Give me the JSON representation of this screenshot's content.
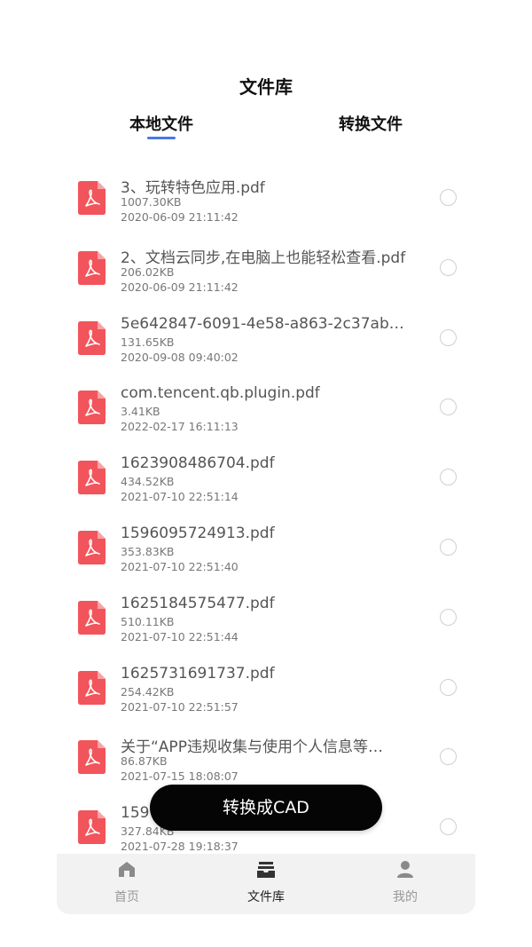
{
  "header": {
    "title": "文件库"
  },
  "tabs": [
    {
      "label": "本地文件",
      "active": true
    },
    {
      "label": "转换文件",
      "active": false
    }
  ],
  "files": [
    {
      "name": "3、玩转特色应用.pdf",
      "size": "1007.30KB",
      "date": "2020-06-09 21:11:42"
    },
    {
      "name": "2、文档云同步,在电脑上也能轻松查看.pdf",
      "size": "206.02KB",
      "date": "2020-06-09 21:11:42"
    },
    {
      "name": "5e642847-6091-4e58-a863-2c37ab…",
      "size": "131.65KB",
      "date": "2020-09-08 09:40:02"
    },
    {
      "name": "com.tencent.qb.plugin.pdf",
      "size": "3.41KB",
      "date": "2022-02-17 16:11:13"
    },
    {
      "name": "1623908486704.pdf",
      "size": "434.52KB",
      "date": "2021-07-10 22:51:14"
    },
    {
      "name": "1596095724913.pdf",
      "size": "353.83KB",
      "date": "2021-07-10 22:51:40"
    },
    {
      "name": "1625184575477.pdf",
      "size": "510.11KB",
      "date": "2021-07-10 22:51:44"
    },
    {
      "name": "1625731691737.pdf",
      "size": "254.42KB",
      "date": "2021-07-10 22:51:57"
    },
    {
      "name": "关于“APP违规收集与使用个人信息等…",
      "size": "86.87KB",
      "date": "2021-07-15 18:08:07"
    },
    {
      "name": "159",
      "size": "327.84KB",
      "date": "2021-07-28 19:18:37"
    }
  ],
  "convert_button": {
    "label": "转换成CAD"
  },
  "bottom_nav": [
    {
      "label": "首页",
      "icon": "home-icon"
    },
    {
      "label": "文件库",
      "icon": "library-icon"
    },
    {
      "label": "我的",
      "icon": "profile-icon"
    }
  ],
  "colors": {
    "pdf_icon": "#f2545b",
    "accent": "#4a78e8",
    "button": "#050505"
  }
}
